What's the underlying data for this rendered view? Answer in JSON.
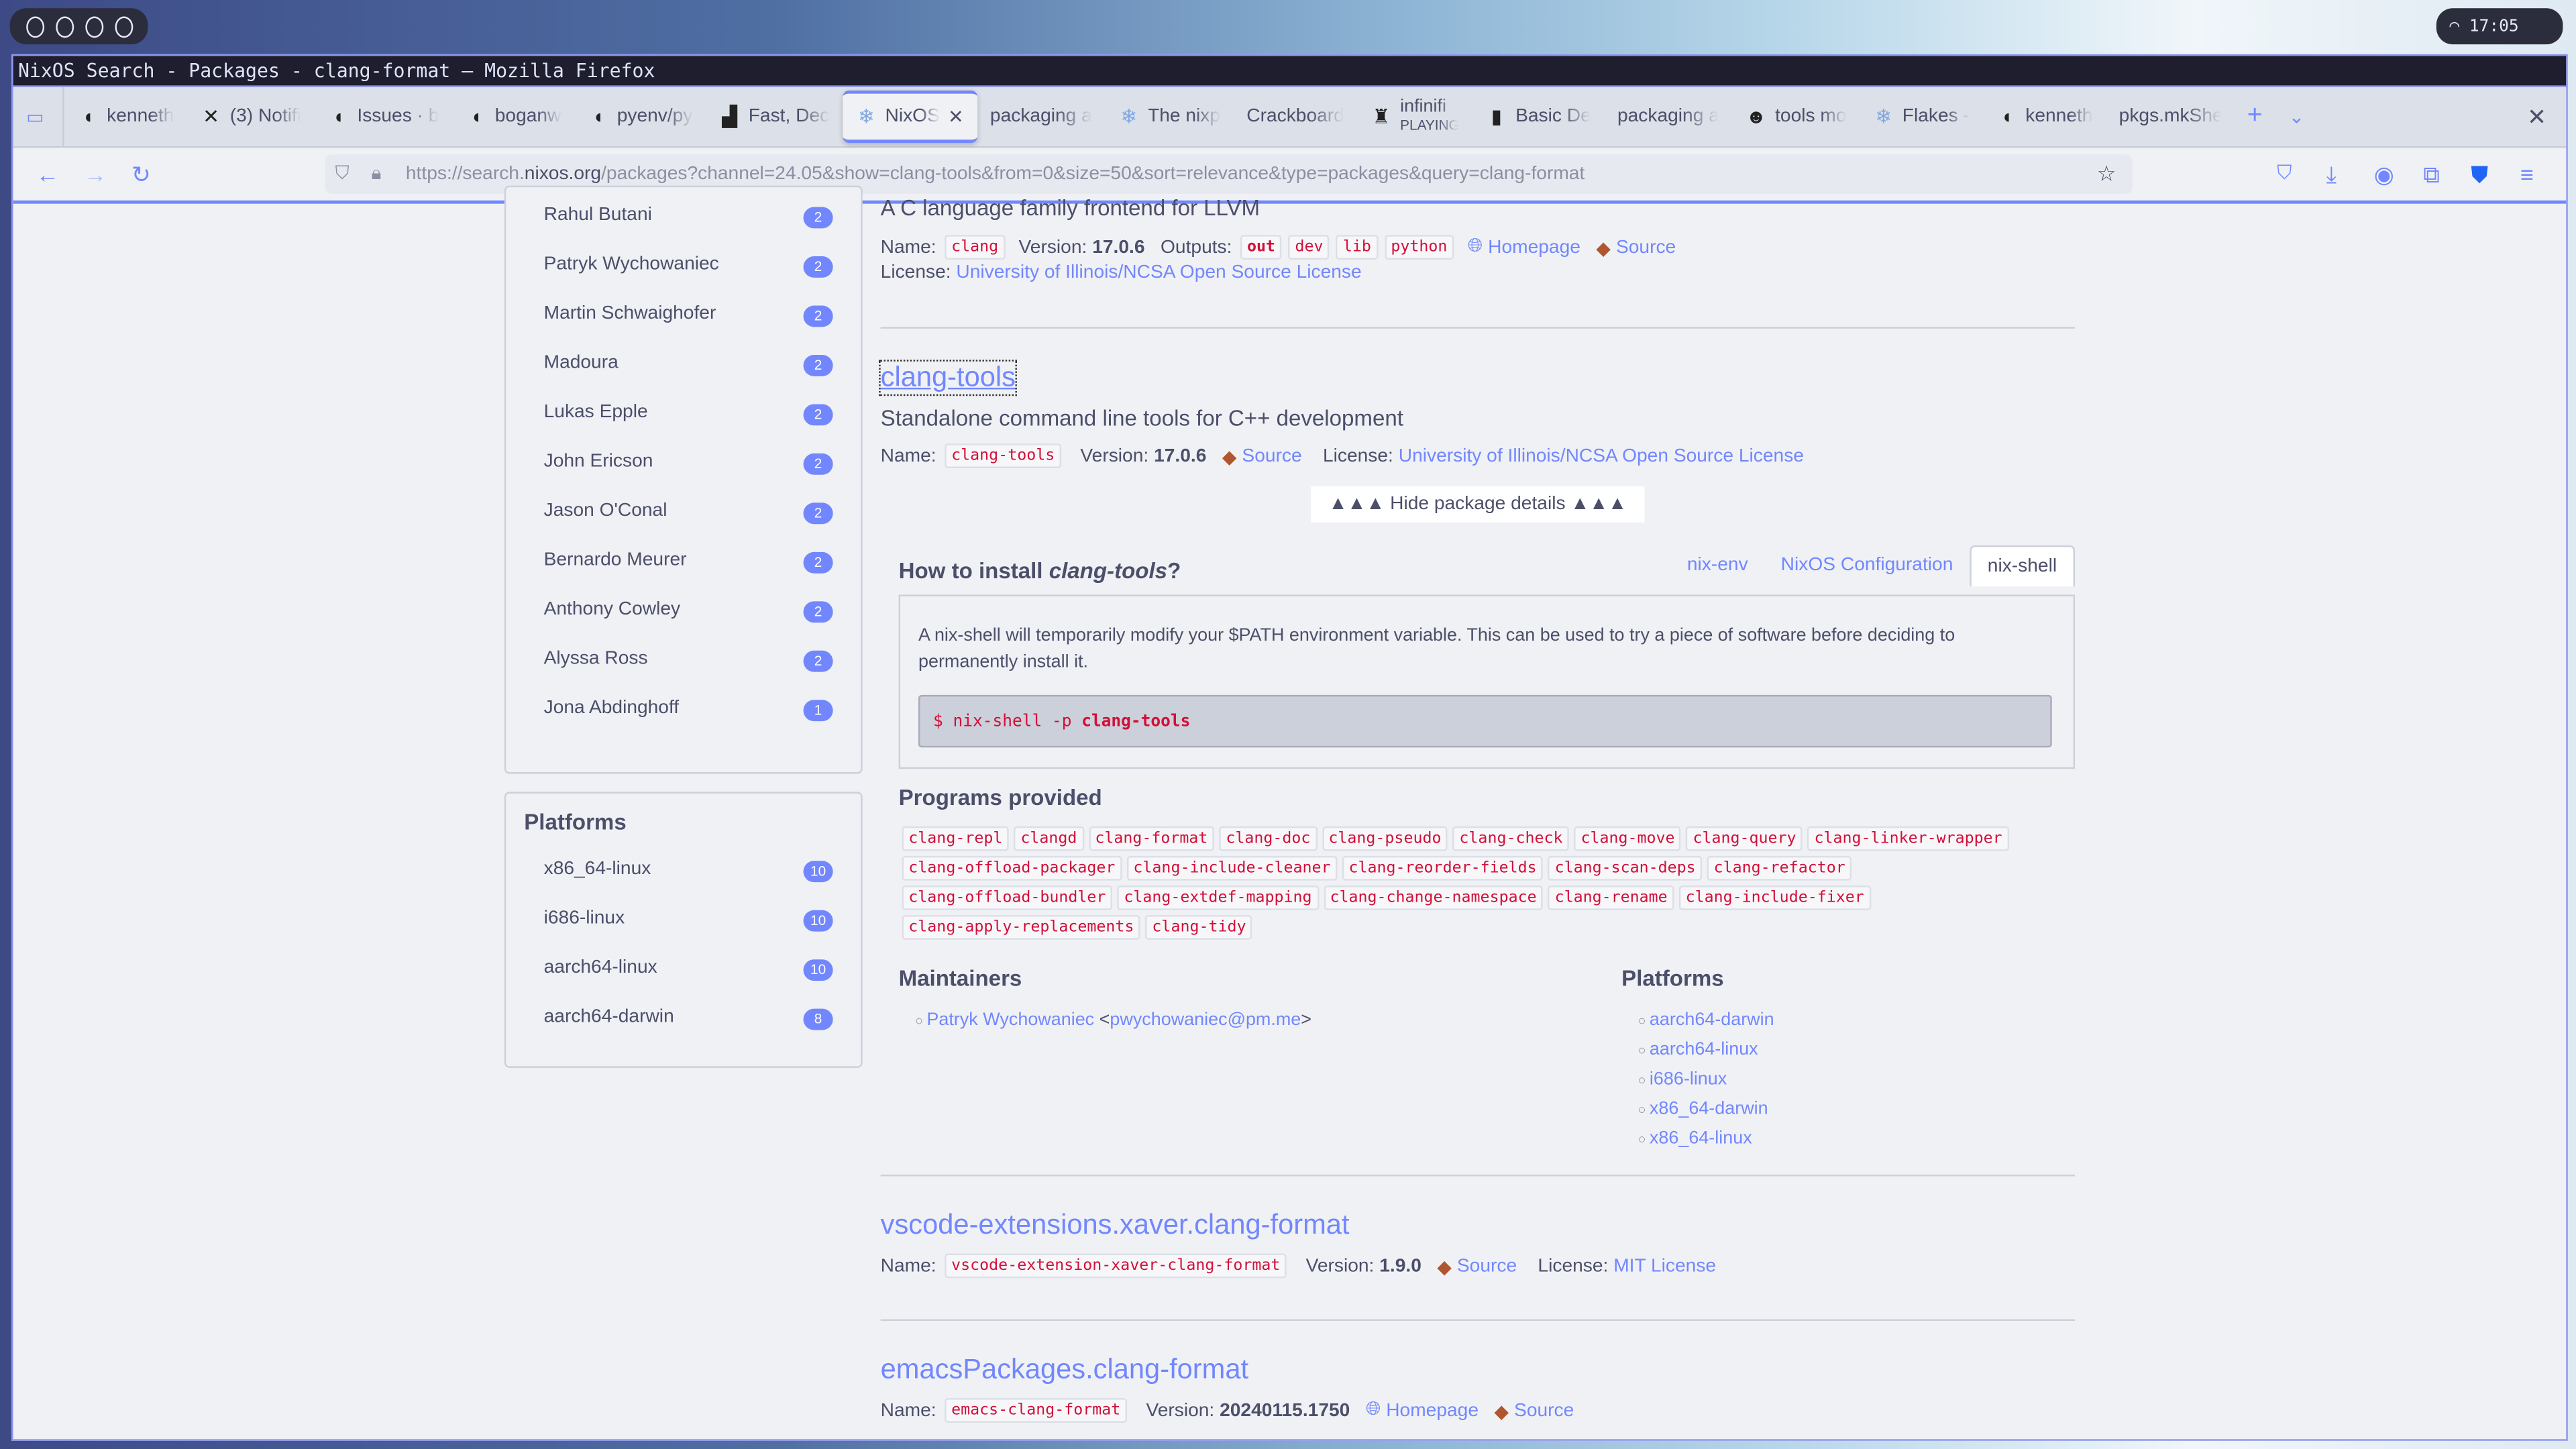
{
  "system": {
    "clock": "17:05",
    "wifi_icon": "wifi-icon",
    "workspaces": 4
  },
  "window_title": "NixOS Search - Packages - clang-format — Mozilla Firefox",
  "tabs": [
    {
      "label": "kenneth",
      "icon": "github-icon"
    },
    {
      "label": "(3) Notifi",
      "icon": "x-icon"
    },
    {
      "label": "Issues · b",
      "icon": "github-icon"
    },
    {
      "label": "boganw",
      "icon": "github-icon"
    },
    {
      "label": "pyenv/py",
      "icon": "github-icon"
    },
    {
      "label": "Fast, Dec",
      "icon": "chart-icon"
    },
    {
      "label": "NixOS",
      "icon": "nixos-icon",
      "active": true
    },
    {
      "label": "packaging a",
      "icon": ""
    },
    {
      "label": "The nixp",
      "icon": "nixos-icon"
    },
    {
      "label": "Crackboard",
      "icon": ""
    },
    {
      "label": "infinifi",
      "sub": "PLAYING",
      "icon": "tower-icon"
    },
    {
      "label": "Basic De",
      "icon": "book-icon"
    },
    {
      "label": "packaging a",
      "icon": ""
    },
    {
      "label": "tools mo",
      "icon": "gopher-icon"
    },
    {
      "label": "Flakes -",
      "icon": "nixos-icon"
    },
    {
      "label": "kenneth",
      "icon": "github-icon"
    },
    {
      "label": "pkgs.mkShe",
      "icon": ""
    }
  ],
  "url": {
    "prefix": "https://search.",
    "domain": "nixos.org",
    "rest": "/packages?channel=24.05&show=clang-tools&from=0&size=50&sort=relevance&type=packages&query=clang-format"
  },
  "maintainers_filter": [
    {
      "name": "Rahul Butani",
      "count": "2"
    },
    {
      "name": "Patryk Wychowaniec",
      "count": "2"
    },
    {
      "name": "Martin Schwaighofer",
      "count": "2"
    },
    {
      "name": "Madoura",
      "count": "2"
    },
    {
      "name": "Lukas Epple",
      "count": "2"
    },
    {
      "name": "John Ericson",
      "count": "2"
    },
    {
      "name": "Jason O'Conal",
      "count": "2"
    },
    {
      "name": "Bernardo Meurer",
      "count": "2"
    },
    {
      "name": "Anthony Cowley",
      "count": "2"
    },
    {
      "name": "Alyssa Ross",
      "count": "2"
    },
    {
      "name": "Jona Abdinghoff",
      "count": "1"
    }
  ],
  "platforms_filter": {
    "title": "Platforms",
    "items": [
      {
        "name": "x86_64-linux",
        "count": "10"
      },
      {
        "name": "i686-linux",
        "count": "10"
      },
      {
        "name": "aarch64-linux",
        "count": "10"
      },
      {
        "name": "aarch64-darwin",
        "count": "8"
      }
    ]
  },
  "labels": {
    "name": "Name:",
    "version": "Version:",
    "outputs": "Outputs:",
    "license": "License:",
    "homepage": "Homepage",
    "source": "Source"
  },
  "clang": {
    "description": "A C language family frontend for LLVM",
    "name": "clang",
    "version": "17.0.6",
    "outputs": [
      "out",
      "dev",
      "lib",
      "python"
    ],
    "license": "University of Illinois/NCSA Open Source License"
  },
  "clang_tools": {
    "title": "clang-tools",
    "description": "Standalone command line tools for C++ development",
    "name": "clang-tools",
    "version": "17.0.6",
    "license": "University of Illinois/NCSA Open Source License",
    "hide_details": "▲▲▲ Hide package details ▲▲▲",
    "install_prefix": "How to install ",
    "install_suffix": "?",
    "install_tabs": [
      "nix-env",
      "NixOS Configuration",
      "nix-shell"
    ],
    "nixshell_text": "A nix-shell will temporarily modify your $PATH environment variable. This can be used to try a piece of software before deciding to permanently install it.",
    "cmd_prompt": "$ nix-shell -p ",
    "cmd_pkg": "clang-tools",
    "programs_title": "Programs provided",
    "programs": [
      "clang-repl",
      "clangd",
      "clang-format",
      "clang-doc",
      "clang-pseudo",
      "clang-check",
      "clang-move",
      "clang-query",
      "clang-linker-wrapper",
      "clang-offload-packager",
      "clang-include-cleaner",
      "clang-reorder-fields",
      "clang-scan-deps",
      "clang-refactor",
      "clang-offload-bundler",
      "clang-extdef-mapping",
      "clang-change-namespace",
      "clang-rename",
      "clang-include-fixer",
      "clang-apply-replacements",
      "clang-tidy"
    ],
    "maintainers_title": "Maintainers",
    "maintainer_name": "Patryk Wychowaniec",
    "maintainer_email": "pwychowaniec@pm.me",
    "platforms_title": "Platforms",
    "platforms": [
      "aarch64-darwin",
      "aarch64-linux",
      "i686-linux",
      "x86_64-darwin",
      "x86_64-linux"
    ]
  },
  "vscode": {
    "title": "vscode-extensions.xaver.clang-format",
    "name": "vscode-extension-xaver-clang-format",
    "version": "1.9.0",
    "license": "MIT License"
  },
  "emacs": {
    "title": "emacsPackages.clang-format",
    "name": "emacs-clang-format",
    "version": "20240115.1750"
  },
  "colors": {
    "accent": "#7287fd",
    "code": "#d20f39",
    "bg": "#eff1f5"
  }
}
